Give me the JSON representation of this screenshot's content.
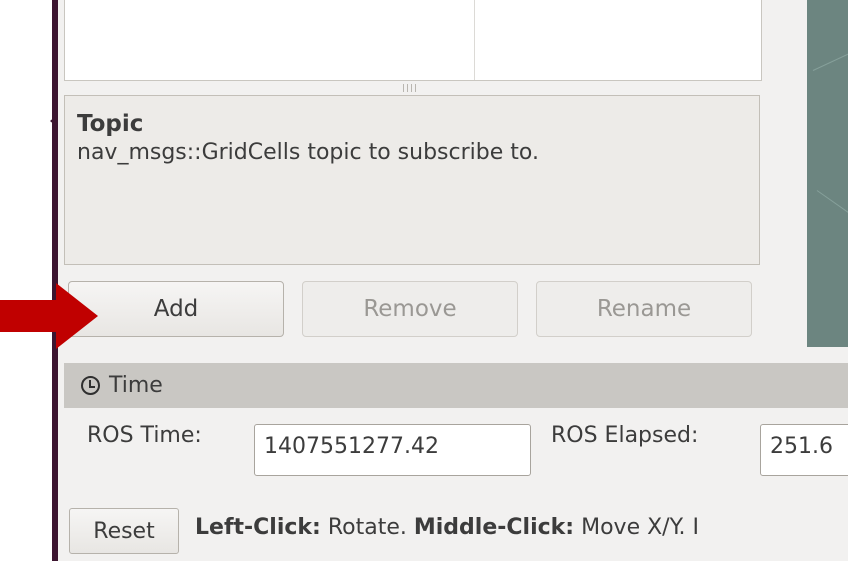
{
  "description_panel": {
    "title": "Topic",
    "text": "nav_msgs::GridCells topic to subscribe to."
  },
  "displays_buttons": {
    "add_label": "Add",
    "remove_label": "Remove",
    "rename_label": "Rename"
  },
  "time_panel": {
    "title": "Time",
    "icon": "clock-icon",
    "ros_time_label": "ROS Time:",
    "ros_time_value": "1407551277.42",
    "ros_elapsed_label": "ROS Elapsed:",
    "ros_elapsed_value": "251.6"
  },
  "status_bar": {
    "reset_label": "Reset",
    "left_click_key": "Left-Click:",
    "left_click_action": " Rotate. ",
    "middle_click_key": "Middle-Click:",
    "middle_click_action": " Move X/Y. I"
  },
  "annotation": {
    "arrow_color": "#c00000",
    "points_to": "add-button"
  }
}
